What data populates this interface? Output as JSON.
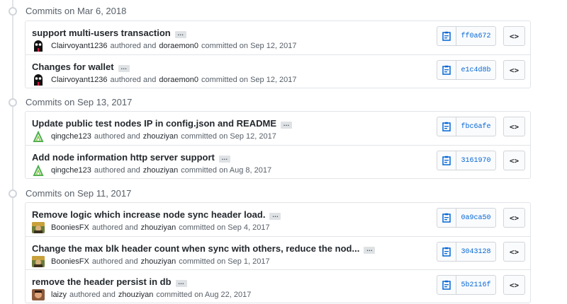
{
  "groups": [
    {
      "title": "Commits on Mar 6, 2018",
      "commits": [
        {
          "message": "support multi-users transaction",
          "author": "Clairvoyant1236",
          "authored": "authored and",
          "committer": "doraemon0",
          "committed": "committed on Sep 12, 2017",
          "sha": "ff0a672",
          "avatar": "ghost-avatar"
        },
        {
          "message": "Changes for wallet",
          "author": "Clairvoyant1236",
          "authored": "authored and",
          "committer": "doraemon0",
          "committed": "committed on Sep 12, 2017",
          "sha": "e1c4d8b",
          "avatar": "ghost-avatar"
        }
      ]
    },
    {
      "title": "Commits on Sep 13, 2017",
      "commits": [
        {
          "message": "Update public test nodes IP in config.json and README",
          "author": "qingche123",
          "authored": "authored and",
          "committer": "zhouziyan",
          "committed": "committed on Sep 12, 2017",
          "sha": "fbc6afe",
          "avatar": "leaf-avatar"
        },
        {
          "message": "Add node information http server support",
          "author": "qingche123",
          "authored": "authored and",
          "committer": "zhouziyan",
          "committed": "committed on Aug 8, 2017",
          "sha": "3161970",
          "avatar": "leaf-avatar"
        }
      ]
    },
    {
      "title": "Commits on Sep 11, 2017",
      "commits": [
        {
          "message": "Remove logic which increase node sync header load.",
          "author": "BooniesFX",
          "authored": "authored and",
          "committer": "zhouziyan",
          "committed": "committed on Sep 4, 2017",
          "sha": "0a9ca50",
          "avatar": "photo-avatar"
        },
        {
          "message": "Change the max blk header count when sync with others, reduce the nod...",
          "author": "BooniesFX",
          "authored": "authored and",
          "committer": "zhouziyan",
          "committed": "committed on Sep 1, 2017",
          "sha": "3043128",
          "avatar": "photo-avatar"
        },
        {
          "message": "remove the header persist in db",
          "author": "laizy",
          "authored": "authored and",
          "committer": "zhouziyan",
          "committed": "committed on Aug 22, 2017",
          "sha": "5b2116f",
          "avatar": "face-avatar"
        }
      ]
    }
  ],
  "ui": {
    "ellipsis": "…",
    "browse": "<>",
    "copy_icon": "clipboard-icon"
  }
}
